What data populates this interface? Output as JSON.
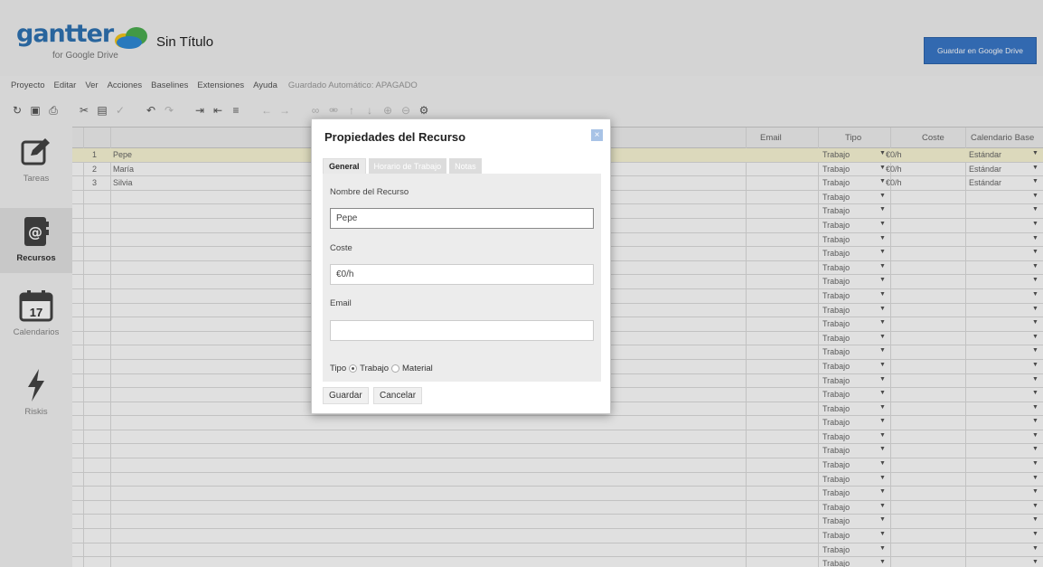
{
  "app": {
    "logo_text": "gantter",
    "logo_sub": "for Google Drive",
    "doc_title": "Sin Título",
    "drive_button": "Guardar en Google Drive"
  },
  "menu": {
    "items": [
      "Proyecto",
      "Editar",
      "Ver",
      "Acciones",
      "Baselines",
      "Extensiones",
      "Ayuda"
    ],
    "autosave": "Guardado Automático: APAGADO"
  },
  "sidebar": {
    "items": [
      {
        "label": "Tareas",
        "icon": "edit-icon"
      },
      {
        "label": "Recursos",
        "icon": "address-book-icon"
      },
      {
        "label": "Calendarios",
        "icon": "calendar-icon",
        "day": "17"
      },
      {
        "label": "Riskis",
        "icon": "lightning-icon"
      }
    ]
  },
  "grid": {
    "headers": {
      "email": "Email",
      "tipo": "Tipo",
      "coste": "Coste",
      "calendario": "Calendario Base"
    },
    "rows": [
      {
        "num": "1",
        "name": "Pepe",
        "tipo": "Trabajo",
        "coste": "€0/h",
        "calendario": "Estándar"
      },
      {
        "num": "2",
        "name": "María",
        "tipo": "Trabajo",
        "coste": "€0/h",
        "calendario": "Estándar"
      },
      {
        "num": "3",
        "name": "Silvia",
        "tipo": "Trabajo",
        "coste": "€0/h",
        "calendario": "Estándar"
      }
    ],
    "empty_tipo": "Trabajo"
  },
  "dialog": {
    "title": "Propiedades del Recurso",
    "tabs": [
      "General",
      "Horario de Trabajo",
      "Notas"
    ],
    "name_label": "Nombre del Recurso",
    "name_value": "Pepe",
    "cost_label": "Coste",
    "cost_value": "€0/h",
    "email_label": "Email",
    "email_value": "",
    "tipo_label": "Tipo",
    "tipo_options": [
      "Trabajo",
      "Material"
    ],
    "tipo_selected": "Trabajo",
    "save": "Guardar",
    "cancel": "Cancelar"
  },
  "colors": {
    "brand": "#2f73b3",
    "drive_button": "#3a78c9",
    "selected_row": "#fbf7d6"
  }
}
